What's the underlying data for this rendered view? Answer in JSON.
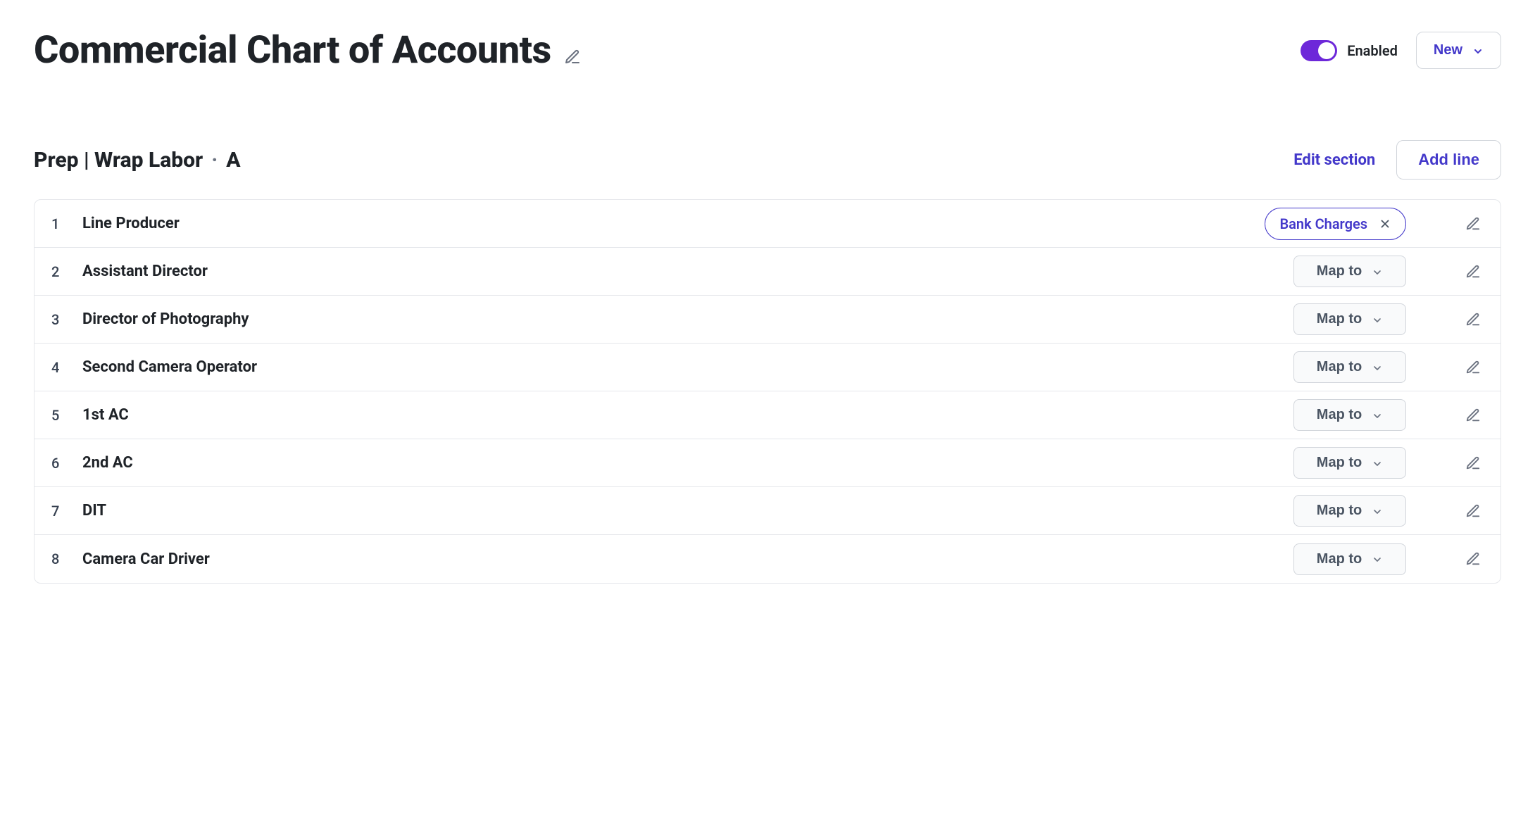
{
  "header": {
    "title": "Commercial Chart of Accounts",
    "toggle_label": "Enabled",
    "toggle_on": true,
    "new_button": "New"
  },
  "section": {
    "title": "Prep | Wrap Labor",
    "code": "A",
    "edit_section": "Edit section",
    "add_line": "Add line"
  },
  "map_to_label": "Map to",
  "rows": [
    {
      "num": "1",
      "name": "Line Producer",
      "mapped": "Bank Charges"
    },
    {
      "num": "2",
      "name": "Assistant Director",
      "mapped": null
    },
    {
      "num": "3",
      "name": "Director of Photography",
      "mapped": null
    },
    {
      "num": "4",
      "name": "Second Camera Operator",
      "mapped": null
    },
    {
      "num": "5",
      "name": "1st AC",
      "mapped": null
    },
    {
      "num": "6",
      "name": "2nd AC",
      "mapped": null
    },
    {
      "num": "7",
      "name": "DIT",
      "mapped": null
    },
    {
      "num": "8",
      "name": "Camera Car Driver",
      "mapped": null
    }
  ]
}
